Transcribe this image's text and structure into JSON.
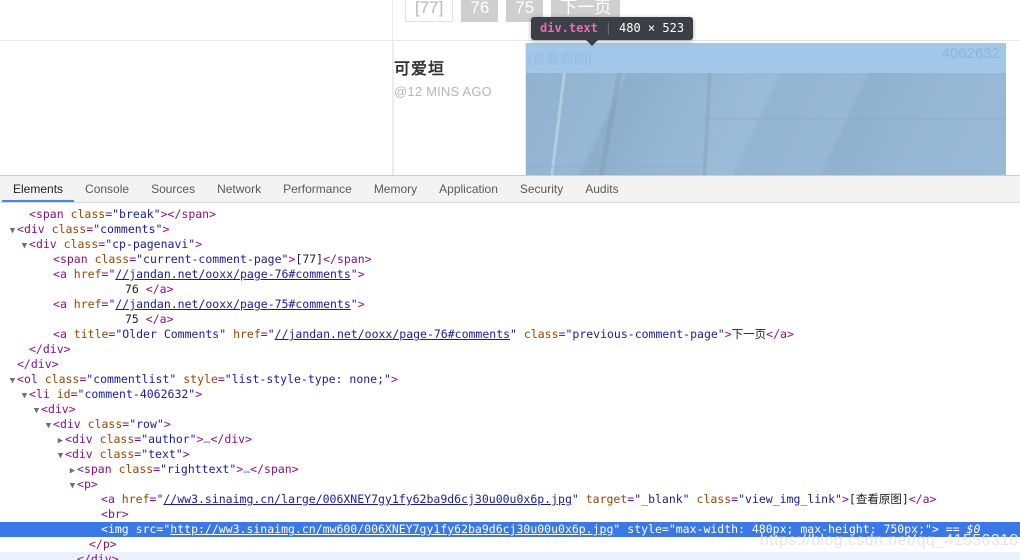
{
  "page": {
    "pagination": [
      {
        "label": "[77]",
        "current": true
      },
      {
        "label": "76",
        "current": false
      },
      {
        "label": "75",
        "current": false
      },
      {
        "label": "下一页",
        "current": false
      }
    ],
    "comment": {
      "author": "可爱垣",
      "time": "@12 MINS AGO",
      "view_img_link": "[查看原图]",
      "comment_id": "4062632"
    }
  },
  "inspector_tooltip": {
    "selector": "div.text",
    "separator": "|",
    "dimensions": "480 × 523"
  },
  "devtools": {
    "tabs": [
      {
        "label": "Elements",
        "active": true
      },
      {
        "label": "Console",
        "active": false
      },
      {
        "label": "Sources",
        "active": false
      },
      {
        "label": "Network",
        "active": false
      },
      {
        "label": "Performance",
        "active": false
      },
      {
        "label": "Memory",
        "active": false
      },
      {
        "label": "Application",
        "active": false
      },
      {
        "label": "Security",
        "active": false
      },
      {
        "label": "Audits",
        "active": false
      }
    ],
    "code_lines": [
      {
        "indent": 1,
        "twisty": "",
        "parts": [
          {
            "t": "pnc",
            "v": "<"
          },
          {
            "t": "tag",
            "v": "span"
          },
          {
            "t": "attr",
            "v": " class"
          },
          {
            "t": "pnc",
            "v": "="
          },
          {
            "t": "val",
            "v": "\"break\""
          },
          {
            "t": "pnc",
            "v": ">"
          },
          {
            "t": "pnc",
            "v": "</"
          },
          {
            "t": "tag",
            "v": "span"
          },
          {
            "t": "pnc",
            "v": ">"
          }
        ]
      },
      {
        "indent": 0,
        "twisty": "▼",
        "parts": [
          {
            "t": "pnc",
            "v": "<"
          },
          {
            "t": "tag",
            "v": "div"
          },
          {
            "t": "attr",
            "v": " class"
          },
          {
            "t": "pnc",
            "v": "="
          },
          {
            "t": "val",
            "v": "\"comments\""
          },
          {
            "t": "pnc",
            "v": ">"
          }
        ]
      },
      {
        "indent": 1,
        "twisty": "▼",
        "parts": [
          {
            "t": "pnc",
            "v": "<"
          },
          {
            "t": "tag",
            "v": "div"
          },
          {
            "t": "attr",
            "v": " class"
          },
          {
            "t": "pnc",
            "v": "="
          },
          {
            "t": "val",
            "v": "\"cp-pagenavi\""
          },
          {
            "t": "pnc",
            "v": ">"
          }
        ]
      },
      {
        "indent": 3,
        "twisty": "",
        "parts": [
          {
            "t": "pnc",
            "v": "<"
          },
          {
            "t": "tag",
            "v": "span"
          },
          {
            "t": "attr",
            "v": " class"
          },
          {
            "t": "pnc",
            "v": "="
          },
          {
            "t": "val",
            "v": "\"current-comment-page\""
          },
          {
            "t": "pnc",
            "v": ">"
          },
          {
            "t": "txt",
            "v": "[77]"
          },
          {
            "t": "pnc",
            "v": "</"
          },
          {
            "t": "tag",
            "v": "span"
          },
          {
            "t": "pnc",
            "v": ">"
          }
        ]
      },
      {
        "indent": 3,
        "twisty": "",
        "parts": [
          {
            "t": "pnc",
            "v": "<"
          },
          {
            "t": "tag",
            "v": "a"
          },
          {
            "t": "attr",
            "v": " href"
          },
          {
            "t": "pnc",
            "v": "="
          },
          {
            "t": "val",
            "v": "\""
          },
          {
            "t": "lnk",
            "v": "//jandan.net/ooxx/page-76#comments"
          },
          {
            "t": "val",
            "v": "\""
          },
          {
            "t": "pnc",
            "v": ">"
          }
        ]
      },
      {
        "indent": 9,
        "twisty": "",
        "parts": [
          {
            "t": "txt",
            "v": "76"
          },
          {
            "t": "txt",
            "v": "            "
          },
          {
            "t": "pnc",
            "v": "</"
          },
          {
            "t": "tag",
            "v": "a"
          },
          {
            "t": "pnc",
            "v": ">"
          }
        ]
      },
      {
        "indent": 3,
        "twisty": "",
        "parts": [
          {
            "t": "pnc",
            "v": "<"
          },
          {
            "t": "tag",
            "v": "a"
          },
          {
            "t": "attr",
            "v": " href"
          },
          {
            "t": "pnc",
            "v": "="
          },
          {
            "t": "val",
            "v": "\""
          },
          {
            "t": "lnk",
            "v": "//jandan.net/ooxx/page-75#comments"
          },
          {
            "t": "val",
            "v": "\""
          },
          {
            "t": "pnc",
            "v": ">"
          }
        ]
      },
      {
        "indent": 9,
        "twisty": "",
        "parts": [
          {
            "t": "txt",
            "v": "75"
          },
          {
            "t": "txt",
            "v": "            "
          },
          {
            "t": "pnc",
            "v": "</"
          },
          {
            "t": "tag",
            "v": "a"
          },
          {
            "t": "pnc",
            "v": ">"
          }
        ]
      },
      {
        "indent": 3,
        "twisty": "",
        "parts": [
          {
            "t": "pnc",
            "v": "<"
          },
          {
            "t": "tag",
            "v": "a"
          },
          {
            "t": "attr",
            "v": " title"
          },
          {
            "t": "pnc",
            "v": "="
          },
          {
            "t": "val",
            "v": "\"Older Comments\""
          },
          {
            "t": "attr",
            "v": " href"
          },
          {
            "t": "pnc",
            "v": "="
          },
          {
            "t": "val",
            "v": "\""
          },
          {
            "t": "lnk",
            "v": "//jandan.net/ooxx/page-76#comments"
          },
          {
            "t": "val",
            "v": "\""
          },
          {
            "t": "attr",
            "v": " class"
          },
          {
            "t": "pnc",
            "v": "="
          },
          {
            "t": "val",
            "v": "\"previous-comment-page\""
          },
          {
            "t": "pnc",
            "v": ">"
          },
          {
            "t": "txt",
            "v": "下一页"
          },
          {
            "t": "pnc",
            "v": "</"
          },
          {
            "t": "tag",
            "v": "a"
          },
          {
            "t": "pnc",
            "v": ">"
          }
        ]
      },
      {
        "indent": 1,
        "twisty": "",
        "parts": [
          {
            "t": "pnc",
            "v": "</"
          },
          {
            "t": "tag",
            "v": "div"
          },
          {
            "t": "pnc",
            "v": ">"
          }
        ]
      },
      {
        "indent": 0,
        "twisty": "",
        "parts": [
          {
            "t": "pnc",
            "v": "</"
          },
          {
            "t": "tag",
            "v": "div"
          },
          {
            "t": "pnc",
            "v": ">"
          }
        ]
      },
      {
        "indent": 0,
        "twisty": "▼",
        "parts": [
          {
            "t": "pnc",
            "v": "<"
          },
          {
            "t": "tag",
            "v": "ol"
          },
          {
            "t": "attr",
            "v": " class"
          },
          {
            "t": "pnc",
            "v": "="
          },
          {
            "t": "val",
            "v": "\"commentlist\""
          },
          {
            "t": "attr",
            "v": " style"
          },
          {
            "t": "pnc",
            "v": "="
          },
          {
            "t": "val",
            "v": "\"list-style-type: none;\""
          },
          {
            "t": "pnc",
            "v": ">"
          }
        ]
      },
      {
        "indent": 1,
        "twisty": "▼",
        "parts": [
          {
            "t": "pnc",
            "v": "<"
          },
          {
            "t": "tag",
            "v": "li"
          },
          {
            "t": "attr",
            "v": " id"
          },
          {
            "t": "pnc",
            "v": "="
          },
          {
            "t": "val",
            "v": "\"comment-4062632\""
          },
          {
            "t": "pnc",
            "v": ">"
          }
        ]
      },
      {
        "indent": 2,
        "twisty": "▼",
        "parts": [
          {
            "t": "pnc",
            "v": "<"
          },
          {
            "t": "tag",
            "v": "div"
          },
          {
            "t": "pnc",
            "v": ">"
          }
        ]
      },
      {
        "indent": 3,
        "twisty": "▼",
        "parts": [
          {
            "t": "pnc",
            "v": "<"
          },
          {
            "t": "tag",
            "v": "div"
          },
          {
            "t": "attr",
            "v": " class"
          },
          {
            "t": "pnc",
            "v": "="
          },
          {
            "t": "val",
            "v": "\"row\""
          },
          {
            "t": "pnc",
            "v": ">"
          }
        ]
      },
      {
        "indent": 4,
        "twisty": "▶",
        "parts": [
          {
            "t": "pnc",
            "v": "<"
          },
          {
            "t": "tag",
            "v": "div"
          },
          {
            "t": "attr",
            "v": " class"
          },
          {
            "t": "pnc",
            "v": "="
          },
          {
            "t": "val",
            "v": "\"author\""
          },
          {
            "t": "pnc",
            "v": ">"
          },
          {
            "t": "ellip",
            "v": "…"
          },
          {
            "t": "pnc",
            "v": "</"
          },
          {
            "t": "tag",
            "v": "div"
          },
          {
            "t": "pnc",
            "v": ">"
          }
        ]
      },
      {
        "indent": 4,
        "twisty": "▼",
        "parts": [
          {
            "t": "pnc",
            "v": "<"
          },
          {
            "t": "tag",
            "v": "div"
          },
          {
            "t": "attr",
            "v": " class"
          },
          {
            "t": "pnc",
            "v": "="
          },
          {
            "t": "val",
            "v": "\"text\""
          },
          {
            "t": "pnc",
            "v": ">"
          }
        ]
      },
      {
        "indent": 5,
        "twisty": "▶",
        "parts": [
          {
            "t": "pnc",
            "v": "<"
          },
          {
            "t": "tag",
            "v": "span"
          },
          {
            "t": "attr",
            "v": " class"
          },
          {
            "t": "pnc",
            "v": "="
          },
          {
            "t": "val",
            "v": "\"righttext\""
          },
          {
            "t": "pnc",
            "v": ">"
          },
          {
            "t": "ellip",
            "v": "…"
          },
          {
            "t": "pnc",
            "v": "</"
          },
          {
            "t": "tag",
            "v": "span"
          },
          {
            "t": "pnc",
            "v": ">"
          }
        ]
      },
      {
        "indent": 5,
        "twisty": "▼",
        "parts": [
          {
            "t": "pnc",
            "v": "<"
          },
          {
            "t": "tag",
            "v": "p"
          },
          {
            "t": "pnc",
            "v": ">"
          }
        ]
      },
      {
        "indent": 7,
        "twisty": "",
        "parts": [
          {
            "t": "pnc",
            "v": "<"
          },
          {
            "t": "tag",
            "v": "a"
          },
          {
            "t": "attr",
            "v": " href"
          },
          {
            "t": "pnc",
            "v": "="
          },
          {
            "t": "val",
            "v": "\""
          },
          {
            "t": "lnk",
            "v": "//ww3.sinaimg.cn/large/006XNEY7gy1fy62ba9d6cj30u00u0x6p.jpg"
          },
          {
            "t": "val",
            "v": "\""
          },
          {
            "t": "attr",
            "v": " target"
          },
          {
            "t": "pnc",
            "v": "="
          },
          {
            "t": "val",
            "v": "\"_blank\""
          },
          {
            "t": "attr",
            "v": " class"
          },
          {
            "t": "pnc",
            "v": "="
          },
          {
            "t": "val",
            "v": "\"view_img_link\""
          },
          {
            "t": "pnc",
            "v": ">"
          },
          {
            "t": "txt",
            "v": "[查看原图]"
          },
          {
            "t": "pnc",
            "v": "</"
          },
          {
            "t": "tag",
            "v": "a"
          },
          {
            "t": "pnc",
            "v": ">"
          }
        ]
      },
      {
        "indent": 7,
        "twisty": "",
        "parts": [
          {
            "t": "pnc",
            "v": "<"
          },
          {
            "t": "tag",
            "v": "br"
          },
          {
            "t": "pnc",
            "v": ">"
          }
        ]
      },
      {
        "indent": 7,
        "twisty": "",
        "selected": true,
        "parts": [
          {
            "t": "pnc",
            "v": "<"
          },
          {
            "t": "tag",
            "v": "img"
          },
          {
            "t": "attr",
            "v": " src"
          },
          {
            "t": "pnc",
            "v": "="
          },
          {
            "t": "val",
            "v": "\""
          },
          {
            "t": "lnk",
            "v": "http://ww3.sinaimg.cn/mw600/006XNEY7gy1fy62ba9d6cj30u00u0x6p.jpg"
          },
          {
            "t": "val",
            "v": "\""
          },
          {
            "t": "attr",
            "v": " style"
          },
          {
            "t": "pnc",
            "v": "="
          },
          {
            "t": "val",
            "v": "\"max-width: 480px; max-height: 750px;\""
          },
          {
            "t": "pnc",
            "v": ">"
          },
          {
            "t": "dollar",
            "v": " == $0"
          }
        ]
      },
      {
        "indent": 6,
        "twisty": "",
        "parts": [
          {
            "t": "pnc",
            "v": "</"
          },
          {
            "t": "tag",
            "v": "p"
          },
          {
            "t": "pnc",
            "v": ">"
          }
        ]
      },
      {
        "indent": 5,
        "twisty": "",
        "hover": true,
        "parts": [
          {
            "t": "pnc",
            "v": "</"
          },
          {
            "t": "tag",
            "v": "div"
          },
          {
            "t": "pnc",
            "v": ">"
          }
        ]
      }
    ]
  },
  "watermark": "https://blog.csdn.net/qq_41556318",
  "colors": {
    "accent": "#4285f4",
    "selected_row": "#3b78e7",
    "tooltip_bg": "#3b3f46",
    "tooltip_tag": "#ea6ab6",
    "highlight_overlay": "#a3c7e8"
  }
}
